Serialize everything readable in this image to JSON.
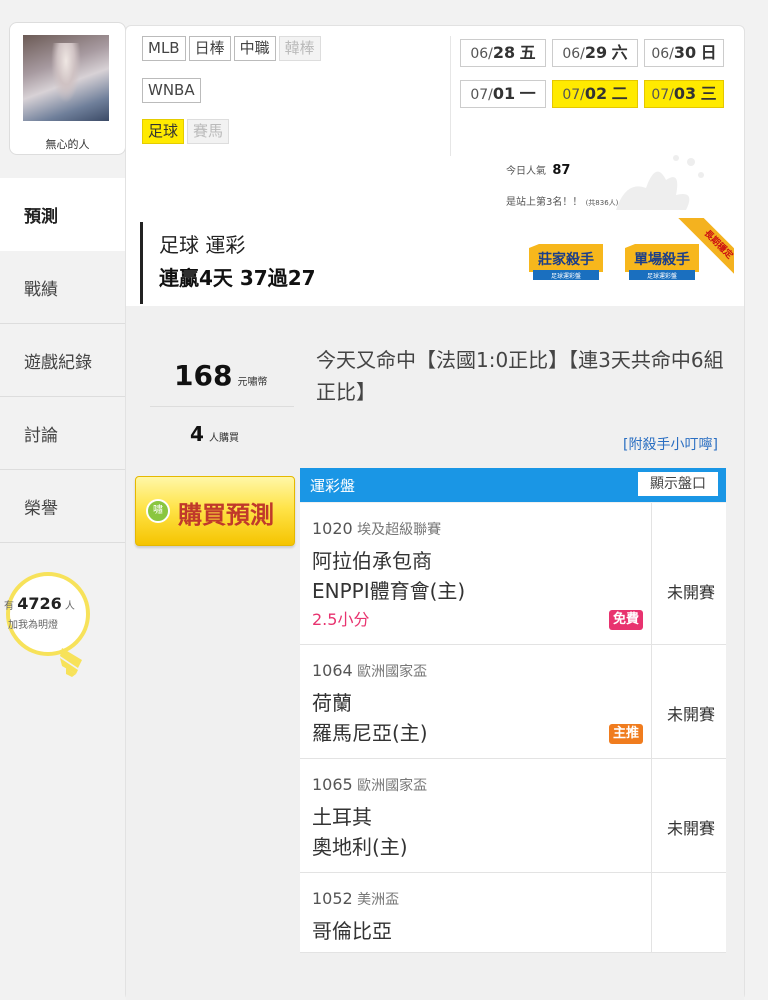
{
  "user": {
    "name": "無心的人"
  },
  "sidebar": {
    "items": [
      {
        "label": "預測",
        "active": true
      },
      {
        "label": "戰績",
        "active": false
      },
      {
        "label": "遊戲紀錄",
        "active": false
      },
      {
        "label": "討論",
        "active": false
      },
      {
        "label": "榮譽",
        "active": false
      }
    ]
  },
  "fans": {
    "prefix": "有",
    "count": "4726",
    "unit": "人",
    "caption": "加我為明燈"
  },
  "sports": {
    "row1": [
      "MLB",
      "日棒",
      "中職",
      "韓棒"
    ],
    "row2": [
      "WNBA"
    ],
    "row3": [
      "足球",
      "賽馬"
    ]
  },
  "dates": [
    {
      "md": "06/",
      "d": "28",
      "wd": "五"
    },
    {
      "md": "06/",
      "d": "29",
      "wd": "六"
    },
    {
      "md": "06/",
      "d": "30",
      "wd": "日"
    },
    {
      "md": "07/",
      "d": "01",
      "wd": "一"
    },
    {
      "md": "07/",
      "d": "02",
      "wd": "二"
    },
    {
      "md": "07/",
      "d": "03",
      "wd": "三"
    }
  ],
  "popularity": {
    "label": "今日人氣",
    "value": "87",
    "rank_text": "是站上第3名！！",
    "rank_note": "(共836人)"
  },
  "banner": {
    "title": "足球 運彩",
    "streak": "連贏4天 37過27",
    "badge1_main": "莊家殺手",
    "badge1_sub": "足球運彩盤",
    "badge2_main": "單場殺手",
    "badge2_sub": "足球運彩盤",
    "ribbon": "長期穩定"
  },
  "stats": {
    "price": "168",
    "price_unit": "元嘯幣",
    "buyers": "4",
    "buyers_unit": "人購買"
  },
  "buy": {
    "icon": "嘯",
    "label": "購買預測"
  },
  "description": "今天又命中【法國1:0正比】【連3天共命中6組正比】",
  "tips_link": "[附殺手小叮嚀]",
  "odds": {
    "title": "運彩盤",
    "show_button": "顯示盤口"
  },
  "games": [
    {
      "no": "1020",
      "league": "埃及超級聯賽",
      "team1": "阿拉伯承包商",
      "team2": "ENPPI體育會(主)",
      "extra": "2.5小分",
      "badge": "免費",
      "status": "未開賽"
    },
    {
      "no": "1064",
      "league": "歐洲國家盃",
      "team1": "荷蘭",
      "team2": "羅馬尼亞(主)",
      "extra": "",
      "badge": "主推",
      "status": "未開賽"
    },
    {
      "no": "1065",
      "league": "歐洲國家盃",
      "team1": "土耳其",
      "team2": "奧地利(主)",
      "extra": "",
      "badge": "",
      "status": "未開賽"
    },
    {
      "no": "1052",
      "league": "美洲盃",
      "team1": "哥倫比亞",
      "team2": "",
      "extra": "",
      "badge": "",
      "status": ""
    }
  ],
  "colors": {
    "accent_blue": "#1a96e5",
    "highlight_yellow": "#ffea00",
    "pink": "#e8336f",
    "badge_free": "#e8336f",
    "badge_main": "#f07c1e"
  }
}
